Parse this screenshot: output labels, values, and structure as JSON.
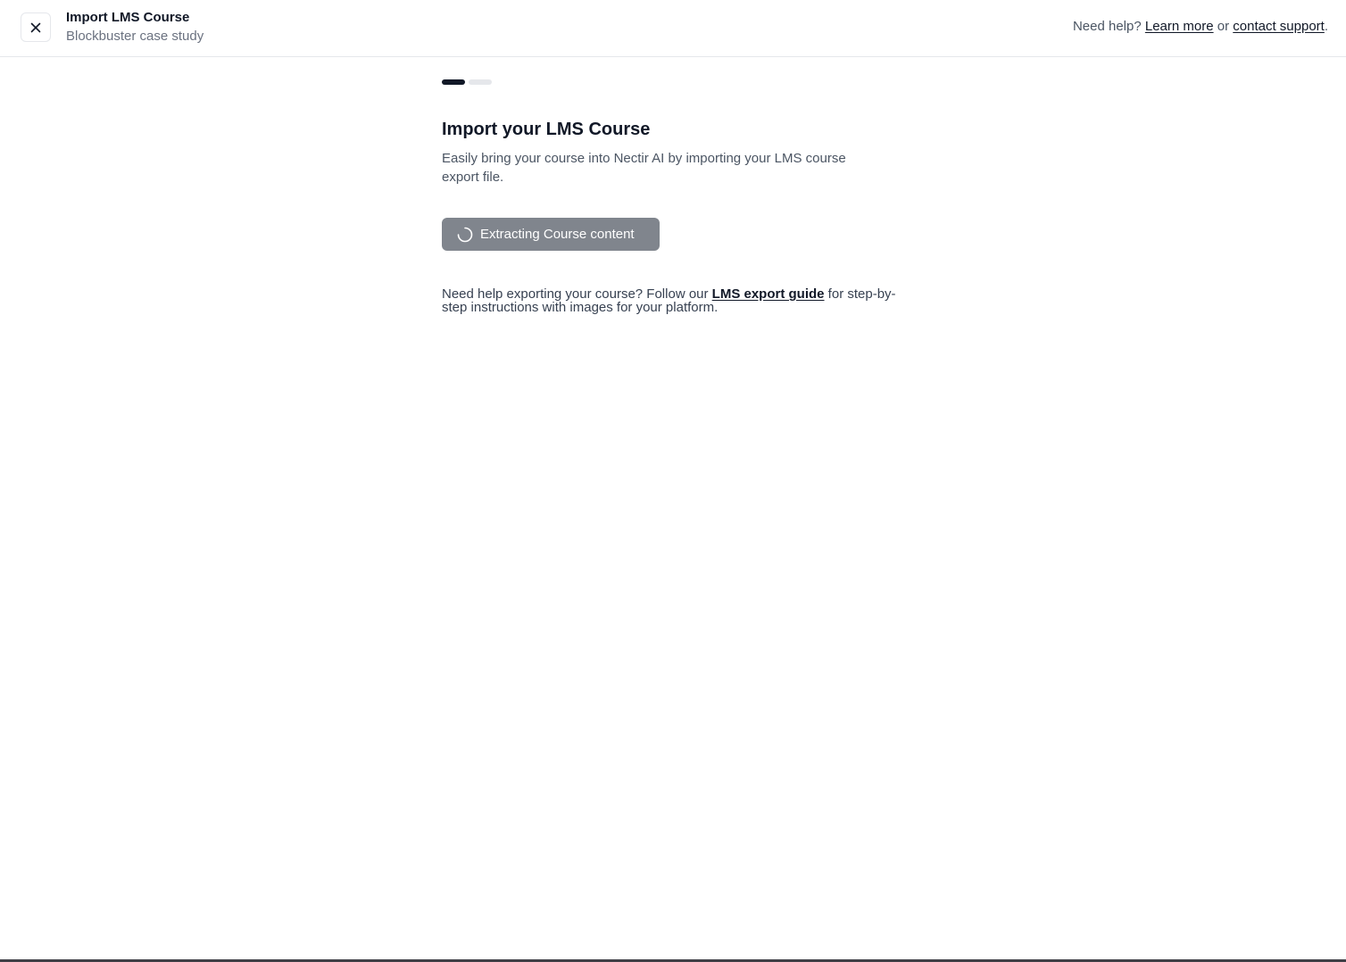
{
  "header": {
    "title": "Import LMS Course",
    "subtitle": "Blockbuster case study",
    "help": {
      "prefix": "Need help? ",
      "learn_more": "Learn more",
      "or": " or ",
      "contact_support": "contact support",
      "suffix": "."
    }
  },
  "steps": {
    "total": 2,
    "current": 1
  },
  "main": {
    "heading": "Import your LMS Course",
    "description": "Easily bring your course into Nectir AI by importing your LMS course export file.",
    "extract_button_label": "Extracting Course content",
    "help": {
      "before": "Need help exporting your course? Follow our ",
      "link": "LMS export guide",
      "after": " for step-by-step instructions with images for your platform."
    }
  },
  "colors": {
    "button_disabled_bg": "#80858d",
    "step_active": "#111827",
    "step_inactive": "#e5e7eb"
  },
  "icons": {
    "close": "close-icon",
    "spinner": "spinner-icon"
  }
}
